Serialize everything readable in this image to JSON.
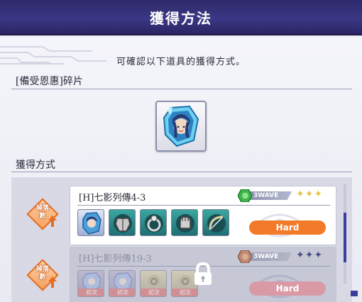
{
  "header": {
    "title": "獲得方法"
  },
  "intro": {
    "text": "可確認以下道具的獲得方式。"
  },
  "item": {
    "name": "[備受恩惠]碎片",
    "icon": "blue-crystal-shard-icon"
  },
  "methods_section": {
    "title": "獲得方式"
  },
  "drop_badge": {
    "line1": "掉落",
    "line2": "數"
  },
  "stages": [
    {
      "name": "[H]七影列傳4-3",
      "wave": "3WAVE",
      "stars": "✦✦✦",
      "difficulty": "Hard",
      "locked": false,
      "rewards": [
        {
          "icon": "character-shard-icon",
          "tag": ""
        },
        {
          "icon": "armor-icon",
          "tag": ""
        },
        {
          "icon": "ring-icon",
          "tag": ""
        },
        {
          "icon": "gauntlet-icon",
          "tag": ""
        },
        {
          "icon": "bow-icon",
          "tag": ""
        }
      ]
    },
    {
      "name": "[H]七影列傳19-3",
      "wave": "3WAVE",
      "stars": "✦✦✦",
      "difficulty": "Hard",
      "locked": true,
      "rewards": [
        {
          "icon": "character-shard-icon",
          "tag": "初次"
        },
        {
          "icon": "character-shard-icon",
          "tag": "初次"
        },
        {
          "icon": "accessory-icon",
          "tag": "初次"
        },
        {
          "icon": "accessory-icon",
          "tag": "初次"
        }
      ]
    }
  ],
  "colors": {
    "header_bg": "#34307a",
    "hard_button": "#f27a28",
    "hard_button_locked": "#d99aa6",
    "star_gold": "#e7c24a",
    "star_locked": "#4a4e86",
    "badge_orange": "#e86c1e"
  }
}
